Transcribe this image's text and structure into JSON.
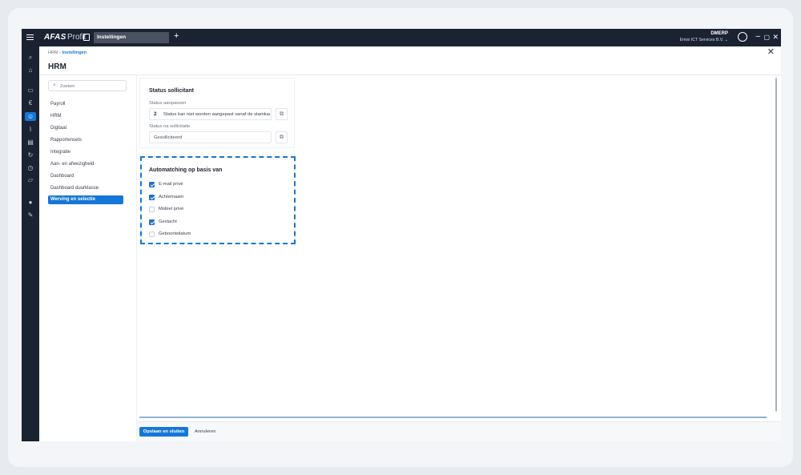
{
  "topbar": {
    "brand": "AFAS",
    "brand_sub": "Profit",
    "tab_label": "Instellingen",
    "add_tab": "+",
    "env_title": "DMERP",
    "env_sub": "Emixi ICT Services B.V. ⌄",
    "minimize": "–",
    "restore": "▢",
    "close": "✕"
  },
  "header": {
    "breadcrumb_root": "HRM",
    "breadcrumb_sep": " › ",
    "breadcrumb_current": "Instellingen",
    "title": "HRM",
    "close": "✕"
  },
  "search": {
    "placeholder": "Zoeken",
    "icon": "search-icon"
  },
  "menu": {
    "items": [
      "Payroll",
      "HRM",
      "Digitaal",
      "Rapportensets",
      "Integratie",
      "Aan- en afwezigheid",
      "Dashboard",
      "Dashboard duurklasse",
      "Werving en selectie"
    ],
    "active_index": 8
  },
  "status_card": {
    "title": "Status sollicitant",
    "field1_label": "Status aanpassen",
    "field1_num": "2",
    "field1_value": "Status kan niet worden aangepast vanaf de stamkaart",
    "field2_label": "Status na sollicitatie",
    "field2_value": "Gesolliciteerd"
  },
  "automatching": {
    "title": "Automatching op basis van",
    "options": [
      {
        "label": "E-mail privé",
        "checked": true
      },
      {
        "label": "Achternaam",
        "checked": true
      },
      {
        "label": "Mobiel privé",
        "checked": false
      },
      {
        "label": "Geslacht",
        "checked": true
      },
      {
        "label": "Geboortedatum",
        "checked": false
      }
    ]
  },
  "progress": {
    "fraction": 1.0
  },
  "footer": {
    "save_label": "Opslaan en sluiten",
    "cancel_label": "Annuleren"
  },
  "colors": {
    "accent": "#1577d6",
    "topbar": "#1b2231"
  }
}
